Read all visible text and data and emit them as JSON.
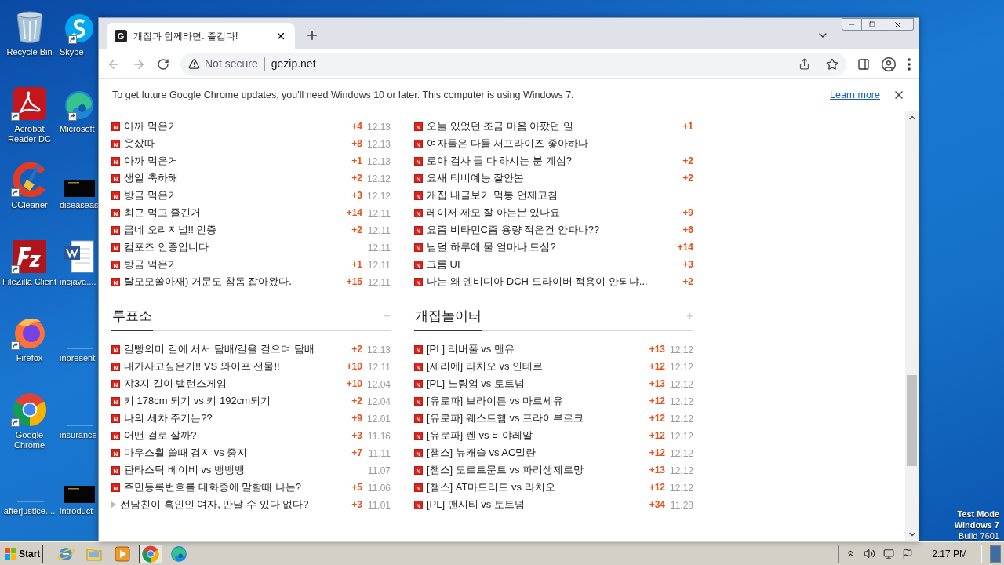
{
  "desktop": {
    "columns": [
      {
        "icons": [
          {
            "label": "Recycle Bin",
            "kind": "recycle",
            "shortcut": false
          },
          {
            "label": "Acrobat Reader DC",
            "kind": "acrobat",
            "shortcut": true
          },
          {
            "label": "CCleaner",
            "kind": "ccleaner",
            "shortcut": true
          },
          {
            "label": "FileZilla Client",
            "kind": "filezilla",
            "shortcut": true
          },
          {
            "label": "Firefox",
            "kind": "firefox",
            "shortcut": true
          },
          {
            "label": "Google Chrome",
            "kind": "chrome",
            "shortcut": true
          },
          {
            "label": "afterjustice....",
            "kind": "blank",
            "shortcut": false
          }
        ]
      },
      {
        "icons": [
          {
            "label": "Skype",
            "kind": "skype",
            "shortcut": true
          },
          {
            "label": "Microsoft",
            "kind": "edge",
            "shortcut": true
          },
          {
            "label": "diseaseas",
            "kind": "dark",
            "shortcut": false
          },
          {
            "label": "incjava....",
            "kind": "word",
            "shortcut": false
          },
          {
            "label": "inpresent",
            "kind": "blank",
            "shortcut": false
          },
          {
            "label": "insurance",
            "kind": "blank",
            "shortcut": false
          },
          {
            "label": "introduct",
            "kind": "dark",
            "shortcut": false
          }
        ]
      }
    ],
    "test_mode": [
      "Test Mode",
      "Windows 7",
      "Build 7601"
    ]
  },
  "browser": {
    "tab": {
      "favicon": "G",
      "title": "개집과 함께라면..즐겁다!"
    },
    "address": {
      "security": "Not secure",
      "url": "gezip.net"
    },
    "infobar": {
      "message": "To get future Google Chrome updates, you'll need Windows 10 or later. This computer is using Windows 7.",
      "link": "Learn more"
    },
    "top_lists": [
      {
        "items": [
          {
            "badge": "N",
            "title": "아까 먹은거",
            "count": "+4",
            "date": "12.13"
          },
          {
            "badge": "N",
            "title": "옷샀따",
            "count": "+8",
            "date": "12.13"
          },
          {
            "badge": "N",
            "title": "아까 먹은거",
            "count": "+1",
            "date": "12.13"
          },
          {
            "badge": "N",
            "title": "생일 축하해",
            "count": "+2",
            "date": "12.12"
          },
          {
            "badge": "N",
            "title": "방금 먹은거",
            "count": "+3",
            "date": "12.12"
          },
          {
            "badge": "N",
            "title": "최근 먹고 즐긴거",
            "count": "+14",
            "date": "12.11"
          },
          {
            "badge": "N",
            "title": "굽네 오리지널!! 인증",
            "count": "+2",
            "date": "12.11"
          },
          {
            "badge": "N",
            "title": "컴포즈 인증입니다",
            "date": "12.11"
          },
          {
            "badge": "N",
            "title": "방금 먹은거",
            "count": "+1",
            "date": "12.11"
          },
          {
            "badge": "N",
            "title": "탈모모쏠아재) 거문도 참돔 잡아왔다.",
            "count": "+15",
            "date": "12.11"
          }
        ]
      },
      {
        "items": [
          {
            "badge": "N",
            "title": "오늘 있었던 조금 마음 아팠던 일",
            "count": "+1"
          },
          {
            "badge": "N",
            "title": "여자들은 다들 서프라이즈 좋아하나"
          },
          {
            "badge": "N",
            "title": "로아 검사 둘 다 하시는 분 계심?",
            "count": "+2"
          },
          {
            "badge": "N",
            "title": "요새 티비예능 잘안봄",
            "count": "+2"
          },
          {
            "badge": "N",
            "title": "개집 내글보기 먹통 언제고침"
          },
          {
            "badge": "N",
            "title": "레이저 제모 잘 아는분 있나요",
            "count": "+9"
          },
          {
            "badge": "N",
            "title": "요즘 비타민C좀 용량 적은건 안파나??",
            "count": "+6"
          },
          {
            "badge": "N",
            "title": "님덜 하루에 물 얼마나 드심?",
            "count": "+14"
          },
          {
            "badge": "N",
            "title": "크롬 UI",
            "count": "+3"
          },
          {
            "badge": "N",
            "title": "나는 왜 엔비디아 DCH 드라이버 적용이 안되냐...",
            "count": "+2"
          }
        ]
      }
    ],
    "boards": [
      {
        "title": "투표소",
        "more": "+",
        "items": [
          {
            "badge": "N",
            "title": "길빵의미 길에 서서 담배/길을 걸으며 담배",
            "count": "+2",
            "date": "12.13"
          },
          {
            "badge": "N",
            "title": "내가사고싶은거!! VS 와이프 선물!!",
            "count": "+10",
            "date": "12.11"
          },
          {
            "badge": "N",
            "title": "쟈3지 길이 밸런스게임",
            "count": "+10",
            "date": "12.04"
          },
          {
            "badge": "N",
            "title": "키 178cm 되기 vs 키 192cm되기",
            "count": "+2",
            "date": "12.04"
          },
          {
            "badge": "N",
            "title": "나의 세차 주기는??",
            "count": "+9",
            "date": "12.01"
          },
          {
            "badge": "N",
            "title": "어떤 걸로 살까?",
            "count": "+3",
            "date": "11.16"
          },
          {
            "badge": "N",
            "title": "마우스휠 쓸때 검지 vs 중지",
            "count": "+7",
            "date": "11.11"
          },
          {
            "badge": "N",
            "title": "판타스틱 베이비 vs 뱅뱅뱅",
            "date": "11.07"
          },
          {
            "badge": "N",
            "title": "주민등록번호를 대화중에 말할때 나는?",
            "count": "+5",
            "date": "11.06"
          },
          {
            "title": "전남친이 흑인인 여자, 만날 수 있다 없다?",
            "count": "+3",
            "date": "11.01"
          }
        ]
      },
      {
        "title": "개집놀이터",
        "more": "+",
        "items": [
          {
            "badge": "N",
            "title": "[PL] 리버풀 vs 맨유",
            "count": "+13",
            "date": "12.12"
          },
          {
            "badge": "N",
            "title": "[세리에] 라치오 vs 인테르",
            "count": "+12",
            "date": "12.12"
          },
          {
            "badge": "N",
            "title": "[PL] 노팅엄 vs 토트넘",
            "count": "+13",
            "date": "12.12"
          },
          {
            "badge": "N",
            "title": "[유로파] 브라이튼 vs 마르세유",
            "count": "+12",
            "date": "12.12"
          },
          {
            "badge": "N",
            "title": "[유로파] 웨스트햄 vs 프라이부르크",
            "count": "+12",
            "date": "12.12"
          },
          {
            "badge": "N",
            "title": "[유로파] 렌 vs 비야레알",
            "count": "+12",
            "date": "12.12"
          },
          {
            "badge": "N",
            "title": "[챔스] 뉴캐슬 vs AC밀란",
            "count": "+12",
            "date": "12.12"
          },
          {
            "badge": "N",
            "title": "[챔스] 도르트문트 vs 파리생제르망",
            "count": "+13",
            "date": "12.12"
          },
          {
            "badge": "N",
            "title": "[챔스] AT마드리드 vs 라치오",
            "count": "+12",
            "date": "12.12"
          },
          {
            "badge": "N",
            "title": "[PL] 맨시티 vs 토트넘",
            "count": "+34",
            "date": "11.28"
          }
        ]
      }
    ]
  },
  "taskbar": {
    "start": "Start",
    "apps": [
      {
        "kind": "ie",
        "selected": false
      },
      {
        "kind": "explorer",
        "selected": false
      },
      {
        "kind": "media",
        "selected": false
      },
      {
        "kind": "chrome",
        "selected": true
      },
      {
        "kind": "edge",
        "selected": false
      }
    ],
    "clock": "2:17 PM"
  }
}
